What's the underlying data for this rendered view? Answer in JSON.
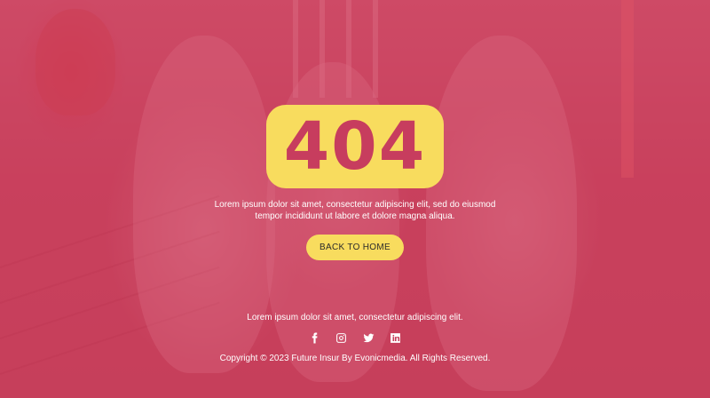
{
  "error_code": "404",
  "message": "Lorem ipsum dolor sit amet, consectetur adipiscing elit, sed do eiusmod tempor incididunt ut labore et dolore magna aliqua.",
  "home_button_label": "BACK TO HOME",
  "footer": {
    "tagline": "Lorem ipsum dolor sit amet, consectetur adipiscing elit.",
    "social_icons": [
      "facebook-icon",
      "instagram-icon",
      "twitter-icon",
      "linkedin-icon"
    ],
    "copyright": "Copyright © 2023 Future Insur By Evonicmedia. All Rights Reserved."
  },
  "colors": {
    "overlay": "#c8375580",
    "accent_yellow": "#f8dc5e",
    "code_text": "#c73d5e",
    "text": "#ffffff"
  }
}
